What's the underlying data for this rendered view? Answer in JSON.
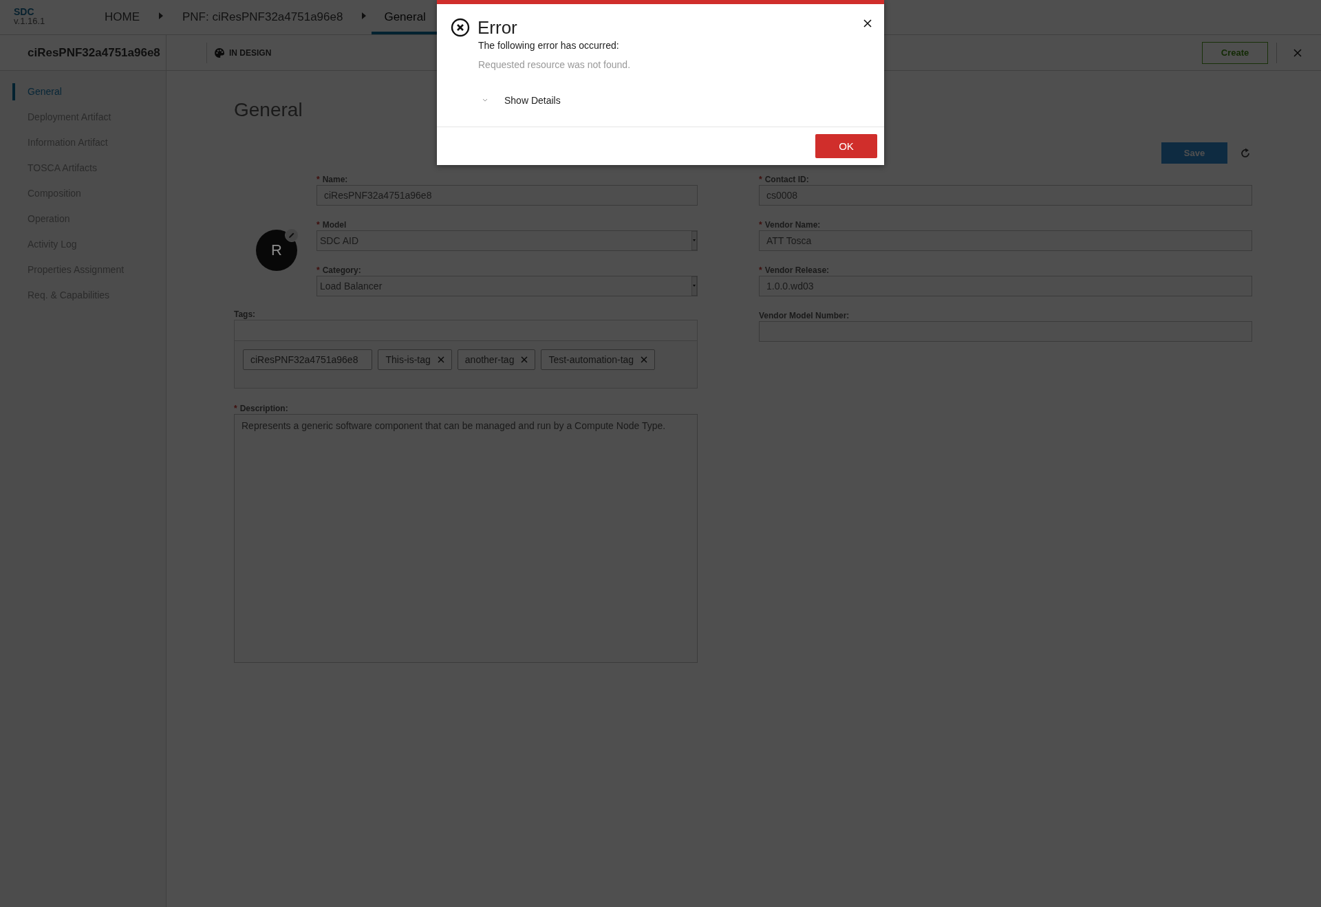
{
  "header": {
    "logo": "SDC",
    "version": "v.1.16.1",
    "breadcrumbs": [
      {
        "label": "HOME",
        "selected": false
      },
      {
        "label": "PNF: ciResPNF32a4751a96e8",
        "selected": false
      },
      {
        "label": "General",
        "selected": true
      }
    ]
  },
  "subheader": {
    "title": "ciResPNF32a4751a96e8",
    "status": "IN DESIGN",
    "create_button": "Create"
  },
  "sidebar": {
    "items": [
      {
        "label": "General",
        "selected": true
      },
      {
        "label": "Deployment Artifact",
        "selected": false
      },
      {
        "label": "Information Artifact",
        "selected": false
      },
      {
        "label": "TOSCA Artifacts",
        "selected": false
      },
      {
        "label": "Composition",
        "selected": false
      },
      {
        "label": "Operation",
        "selected": false
      },
      {
        "label": "Activity Log",
        "selected": false
      },
      {
        "label": "Properties Assignment",
        "selected": false
      },
      {
        "label": "Req. & Capabilities",
        "selected": false
      }
    ]
  },
  "main": {
    "heading": "General",
    "save_button": "Save",
    "avatar_initial": "R",
    "fields_left": [
      {
        "label": "Name:",
        "marker": "*",
        "kind": "text",
        "value": "ciResPNF32a4751a96e8"
      },
      {
        "label": "Model",
        "marker": "*",
        "kind": "select",
        "value": "SDC AID"
      },
      {
        "label": "Category:",
        "marker": "*",
        "kind": "select",
        "value": "Load Balancer"
      }
    ],
    "tags": {
      "label": "Tags:",
      "items": [
        {
          "label": "ciResPNF32a4751a96e8",
          "removable": false
        },
        {
          "label": "This-is-tag",
          "removable": true
        },
        {
          "label": "another-tag",
          "removable": true
        },
        {
          "label": "Test-automation-tag",
          "removable": true
        }
      ]
    },
    "description": {
      "label": "Description:",
      "marker": "*",
      "value": "Represents a generic software component that can be managed and run by a Compute Node Type."
    },
    "fields_right": [
      {
        "label": "Contact ID:",
        "marker": "*",
        "kind": "text",
        "value": "cs0008"
      },
      {
        "label": "Vendor Name:",
        "marker": "*",
        "kind": "text",
        "value": "ATT Tosca"
      },
      {
        "label": "Vendor Release:",
        "marker": "*",
        "kind": "text",
        "value": "1.0.0.wd03"
      },
      {
        "label": "Vendor Model Number:",
        "kind": "text"
      }
    ]
  },
  "dialog": {
    "title": "Error",
    "message": "The following error has occurred:",
    "detail": "Requested resource was not found.",
    "details_toggle": "Show Details",
    "expanded": false,
    "ok_button": "OK"
  }
}
